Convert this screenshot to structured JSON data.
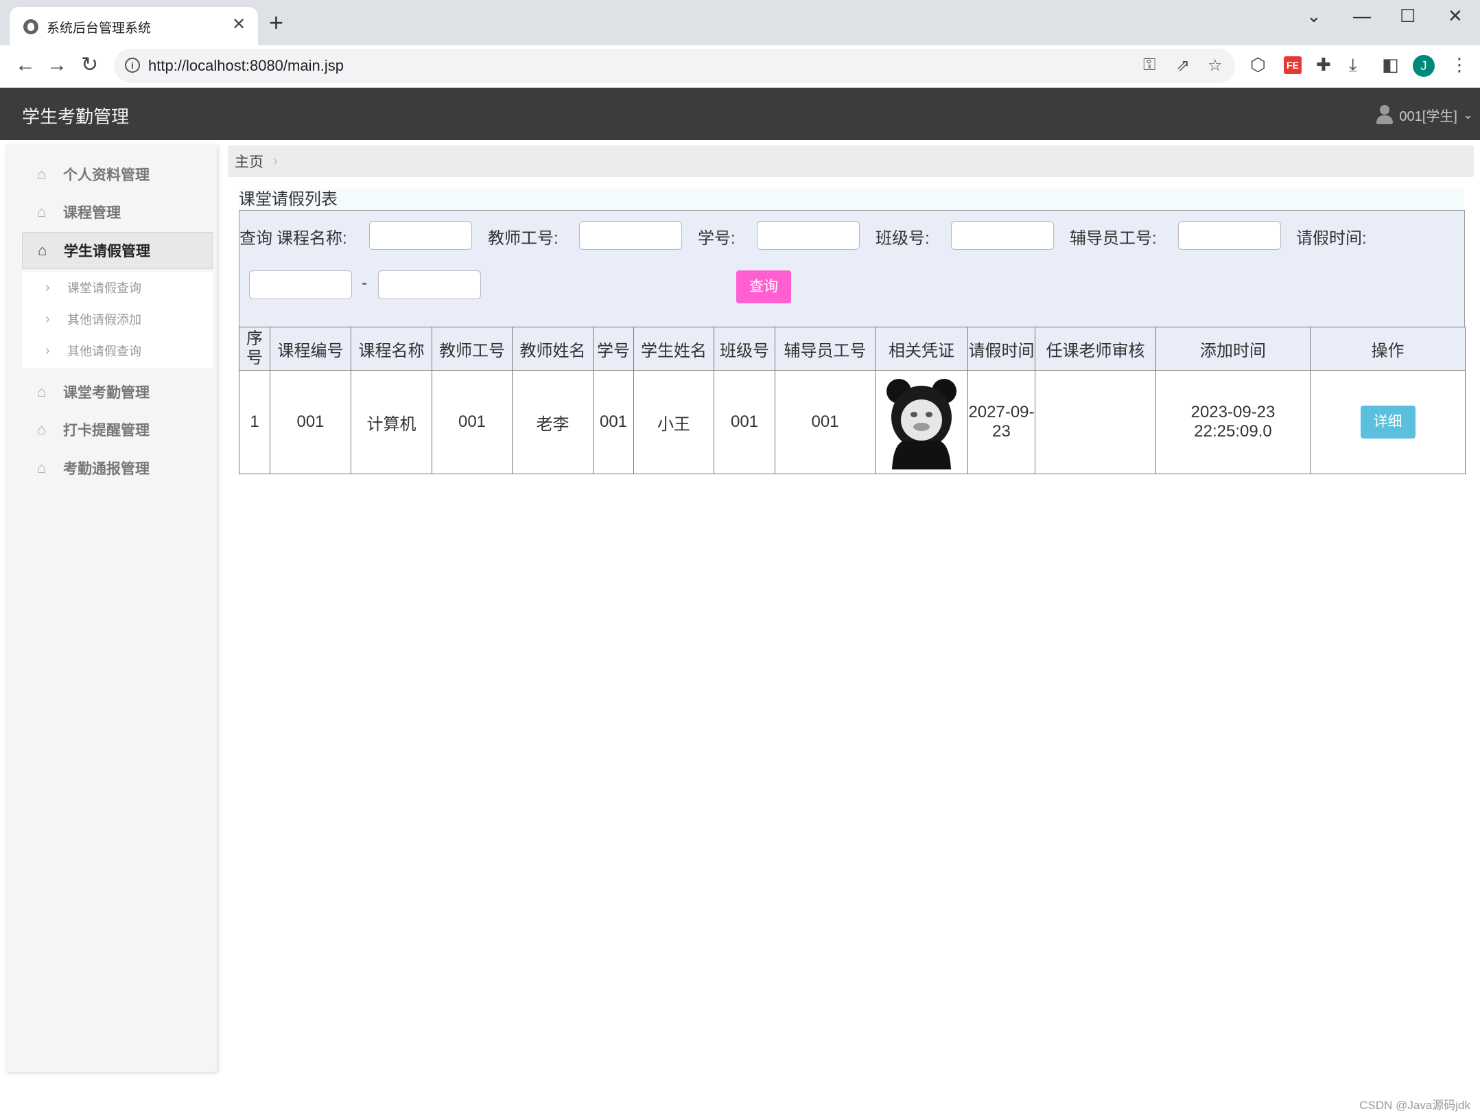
{
  "browser": {
    "tab_title": "系统后台管理系统",
    "tab_close": "✕",
    "new_tab": "+",
    "url": "http://localhost:8080/main.jsp",
    "profile_initial": "J"
  },
  "app": {
    "title": "学生考勤管理",
    "user_label": "001[学生]"
  },
  "sidebar": {
    "items": [
      {
        "label": "个人资料管理"
      },
      {
        "label": "课程管理"
      },
      {
        "label": "学生请假管理"
      },
      {
        "label": "课堂考勤管理"
      },
      {
        "label": "打卡提醒管理"
      },
      {
        "label": "考勤通报管理"
      }
    ],
    "active_index": 2,
    "sub_items": [
      {
        "label": "课堂请假查询"
      },
      {
        "label": "其他请假添加"
      },
      {
        "label": "其他请假查询"
      }
    ]
  },
  "breadcrumb": {
    "home": "主页"
  },
  "list": {
    "title": "课堂请假列表",
    "search": {
      "prefix": "查询",
      "course_name_label": "课程名称:",
      "teacher_id_label": "教师工号:",
      "student_id_label": "学号:",
      "class_id_label": "班级号:",
      "counselor_id_label": "辅导员工号:",
      "leave_time_label": "请假时间:",
      "range_sep": "-",
      "button": "查询"
    },
    "columns": [
      "序号",
      "课程编号",
      "课程名称",
      "教师工号",
      "教师姓名",
      "学号",
      "学生姓名",
      "班级号",
      "辅导员工号",
      "相关凭证",
      "请假时间",
      "任课老师审核",
      "添加时间",
      "操作"
    ],
    "rows": [
      {
        "index": "1",
        "course_no": "001",
        "course_name": "计算机",
        "teacher_id": "001",
        "teacher_name": "老李",
        "student_id": "001",
        "student_name": "小王",
        "class_id": "001",
        "counselor_id": "001",
        "leave_time": "2027-09-23",
        "review": "",
        "added_time": "2023-09-23 22:25:09.0",
        "action": "详细"
      }
    ]
  },
  "watermark": "CSDN @Java源码jdk"
}
